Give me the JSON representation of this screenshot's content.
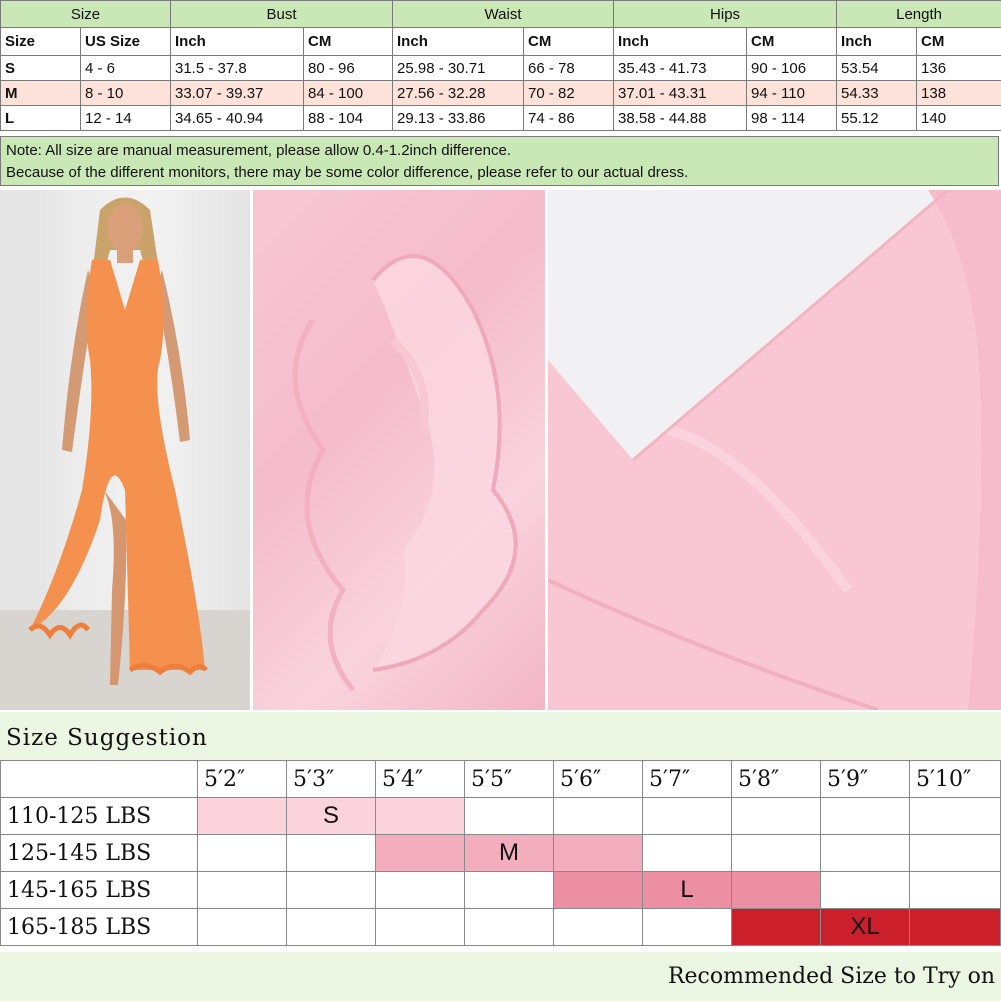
{
  "size_chart": {
    "group_headers": [
      "Size",
      "Bust",
      "Waist",
      "Hips",
      "Length"
    ],
    "sub_headers": [
      "Size",
      "US Size",
      "Inch",
      "CM",
      "Inch",
      "CM",
      "Inch",
      "CM",
      "Inch",
      "CM"
    ],
    "rows": [
      [
        "S",
        "4 - 6",
        "31.5 - 37.8",
        "80 - 96",
        "25.98 - 30.71",
        "66 - 78",
        "35.43 - 41.73",
        "90 - 106",
        "53.54",
        "136"
      ],
      [
        "M",
        "8 - 10",
        "33.07 - 39.37",
        "84 - 100",
        "27.56 - 32.28",
        "70 - 82",
        "37.01 - 43.31",
        "94 - 110",
        "54.33",
        "138"
      ],
      [
        "L",
        "12 - 14",
        "34.65 - 40.94",
        "88 - 104",
        "29.13 - 33.86",
        "74 - 86",
        "38.58 - 44.88",
        "98 - 114",
        "55.12",
        "140"
      ]
    ],
    "notes": [
      "Note: All size are manual measurement, please allow 0.4-1.2inch difference.",
      "Because of the different monitors, there may be some color difference, please refer to our actual dress."
    ]
  },
  "colors": {
    "header_green": "#c9e8b5",
    "row_highlight": "#fde2da",
    "dress_orange": "#f5914f",
    "dress_pink": "#f8c7d3",
    "s_pink": "#fad3dc",
    "m_pink": "#f3aebd",
    "l_pink": "#ec8fa3",
    "xl_red": "#cc1f2c"
  },
  "size_suggestion": {
    "title": "Size Suggestion",
    "heights": [
      "5′2″",
      "5′3″",
      "5′4″",
      "5′5″",
      "5′6″",
      "5′7″",
      "5′8″",
      "5′9″",
      "5′10″"
    ],
    "weights": [
      "110-125 LBS",
      "125-145 LBS",
      "145-165 LBS",
      "165-185 LBS"
    ],
    "sizes": [
      "S",
      "M",
      "L",
      "XL"
    ],
    "footer": "Recommended Size to Try on"
  }
}
